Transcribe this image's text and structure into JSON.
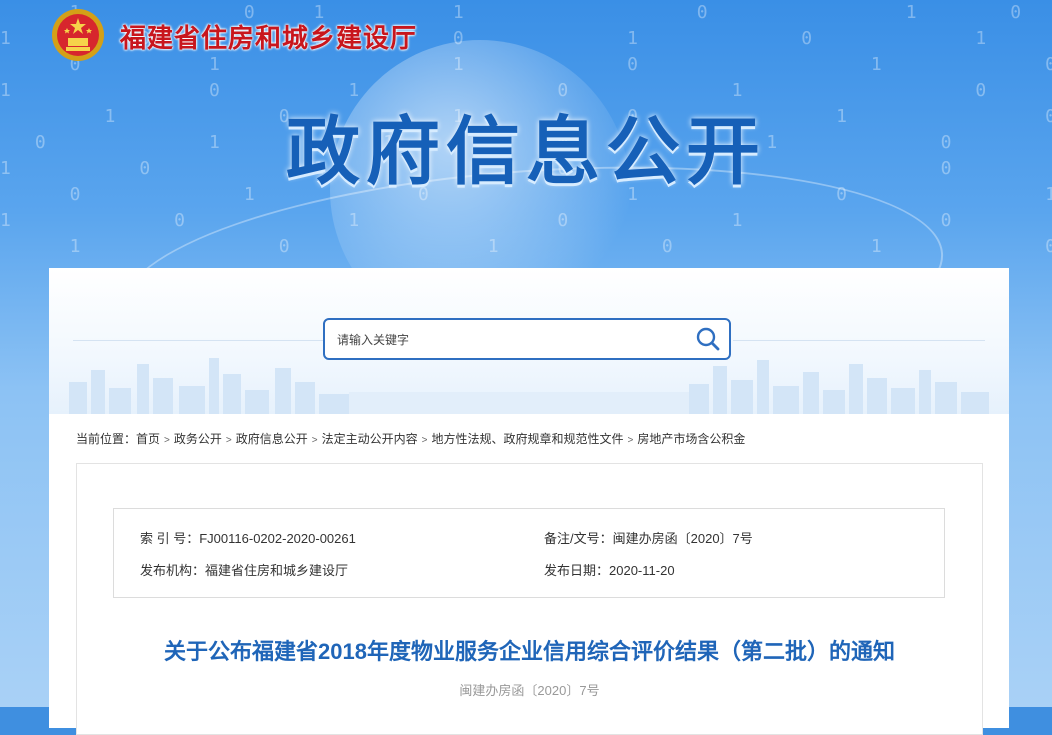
{
  "header": {
    "site_title": "福建省住房和城乡建设厅",
    "hero_title": "政府信息公开",
    "emblem_icon": "national-emblem-icon"
  },
  "search": {
    "placeholder": "请输入关键字",
    "icon": "search-icon"
  },
  "breadcrumb": {
    "prefix": "当前位置：",
    "items": [
      "首页",
      "政务公开",
      "政府信息公开",
      "法定主动公开内容",
      "地方性法规、政府规章和规范性文件",
      "房地产市场含公积金"
    ]
  },
  "meta": {
    "index_label": "索 引 号：",
    "index_value": "FJ00116-0202-2020-00261",
    "doc_label": "备注/文号：",
    "doc_value": "闽建办房函〔2020〕7号",
    "publisher_label": "发布机构：",
    "publisher_value": "福建省住房和城乡建设厅",
    "date_label": "发布日期：",
    "date_value": "2020-11-20"
  },
  "document": {
    "title": "关于公布福建省2018年度物业服务企业信用综合评价结果（第二批）的通知",
    "number": "闽建办房函〔2020〕7号"
  },
  "colors": {
    "accent": "#2f6fc1",
    "title_red": "#c8161d",
    "doc_title_blue": "#1f65b8"
  }
}
